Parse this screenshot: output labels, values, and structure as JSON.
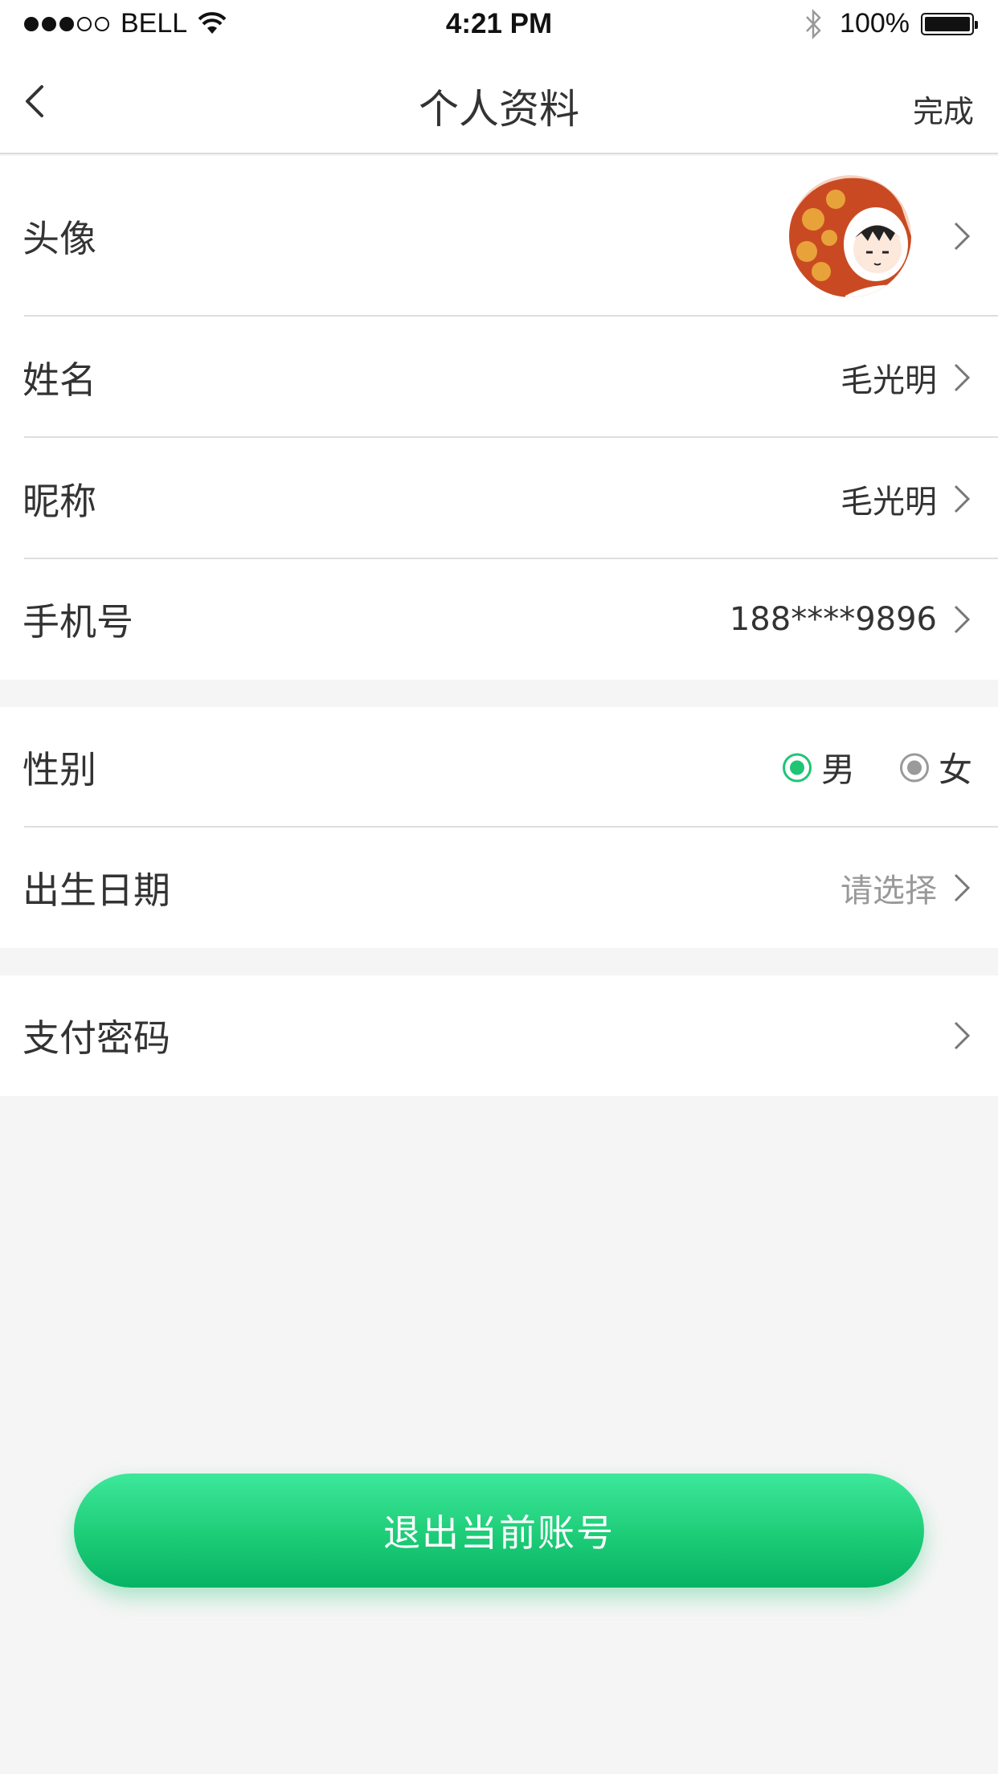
{
  "status_bar": {
    "carrier": "BELL",
    "time": "4:21 PM",
    "battery": "100%",
    "signal_bars": 3,
    "signal_max": 5
  },
  "nav": {
    "back_icon": "chevron-left-icon",
    "title": "个人资料",
    "done_label": "完成"
  },
  "profile": {
    "avatar_label": "头像",
    "name_label": "姓名",
    "name_value": "毛光明",
    "nickname_label": "昵称",
    "nickname_value": "毛光明",
    "phone_label": "手机号",
    "phone_value": "188****9896"
  },
  "details": {
    "gender_label": "性别",
    "gender_options": [
      "男",
      "女"
    ],
    "gender_selected": "男",
    "birthday_label": "出生日期",
    "birthday_placeholder": "请选择"
  },
  "security": {
    "pay_password_label": "支付密码"
  },
  "logout_label": "退出当前账号",
  "colors": {
    "accent": "#1fc574",
    "button_top": "#3de89a",
    "button_bottom": "#06b364",
    "background": "#f5f5f5"
  }
}
